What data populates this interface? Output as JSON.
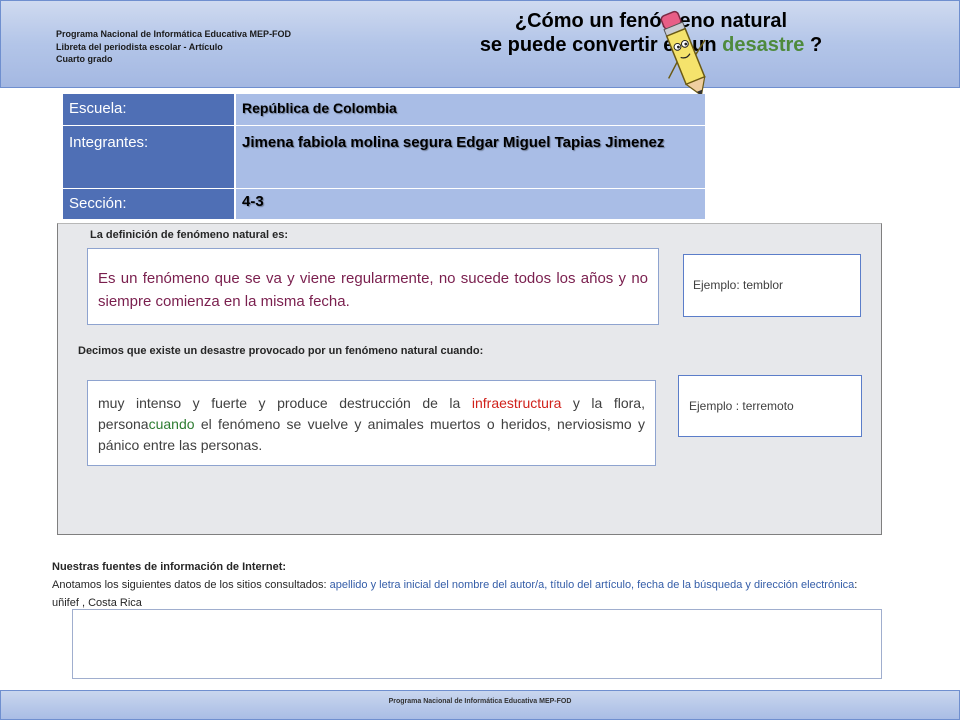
{
  "header": {
    "line1": "Programa Nacional de Informática Educativa MEP-FOD",
    "line2": "Libreta del periodista escolar -  Artículo",
    "line3": "Cuarto grado",
    "title_line1": "¿Cómo un fenómeno natural",
    "title_line2_a": "se puede convertir en un ",
    "title_line2_b": "desastre",
    "title_line2_c": " ?"
  },
  "info": {
    "school_label": "Escuela:",
    "school_value": "República de Colombia",
    "members_label": "Integrantes:",
    "members_value": "Jimena   fabiola  molina  segura Edgar Miguel Tapias Jimenez",
    "section_label": "Sección:",
    "section_value": "4-3"
  },
  "content": {
    "q1": "La definición de  fenómeno natural es:",
    "a1": "Es un fenómeno que se va  y viene regularmente, no sucede todos los años y no siempre comienza en la misma fecha.",
    "ex1": "Ejemplo: temblor",
    "q2": "Decimos que existe un desastre provocado por un fenómeno natural cuando:",
    "a2_1": "muy intenso y fuerte y produce destrucción de la ",
    "a2_2": "infraestructura",
    "a2_3": " y la flora, persona",
    "a2_4": "cuando",
    "a2_5": " el fenómeno se vuelve y animales muertos o heridos, nerviosismo y pánico entre las personas.",
    "ex2": "Ejemplo : terremoto"
  },
  "sources": {
    "title": "Nuestras fuentes de información de Internet:",
    "text_a": "Anotamos los siguientes datos de los sitios consultados: ",
    "text_b": "apellido y letra inicial del nombre del autor/a,  título del artículo, fecha de la búsqueda y dirección electrónica",
    "text_c": ": uñifef , Costa Rica",
    "box_value": ""
  },
  "footer": {
    "text": "Programa  Nacional de Informática  Educativa MEP-FOD"
  },
  "colors": {
    "label_bg": "#4f6fb5",
    "value_bg": "#a9bde6",
    "header_bg": "#b3c5e8",
    "accent_green": "#4e8a3c",
    "highlight_red": "#d0211b"
  },
  "icons": {
    "mascot": "pencil-mascot-icon"
  }
}
